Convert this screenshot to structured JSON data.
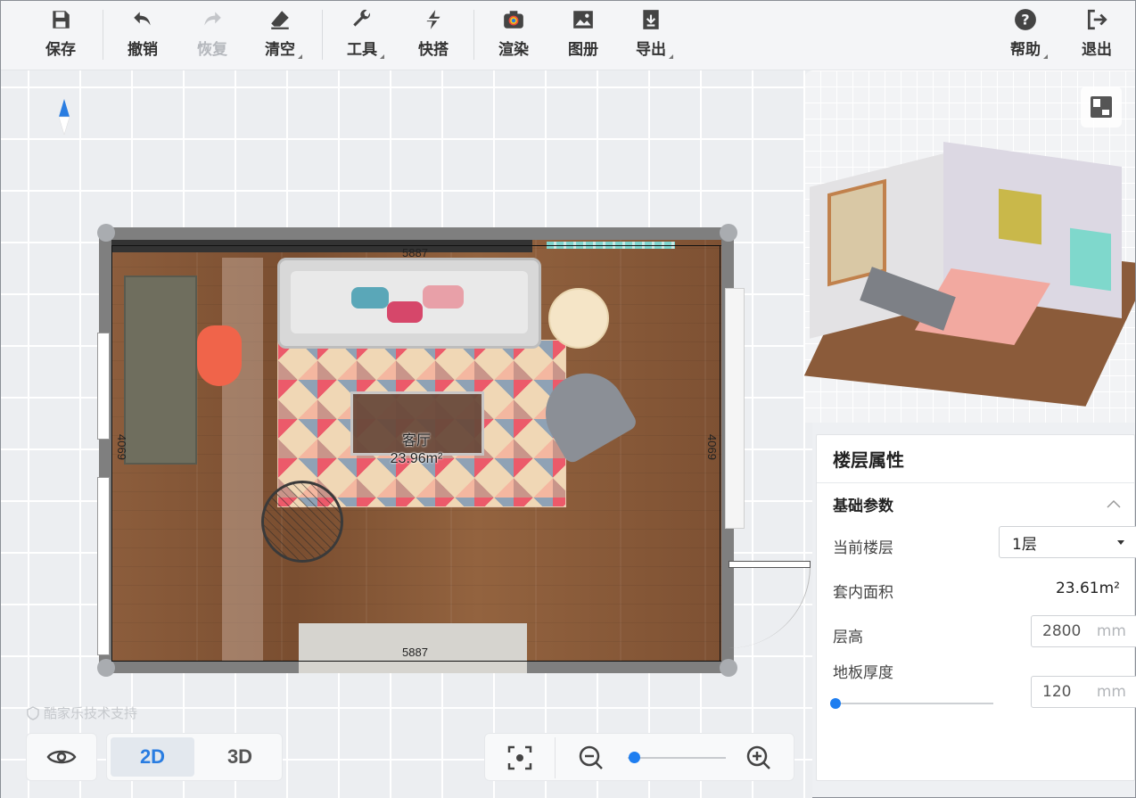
{
  "toolbar": {
    "save": "保存",
    "undo": "撤销",
    "redo": "恢复",
    "clear": "清空",
    "tools": "工具",
    "quick": "快搭",
    "render": "渲染",
    "album": "图册",
    "export": "导出",
    "help": "帮助",
    "exit": "退出"
  },
  "plan": {
    "room_name": "客厅",
    "room_area": "23.96m²",
    "dim_top": "5887",
    "dim_bottom": "5887",
    "dim_left": "4069",
    "dim_right": "4069"
  },
  "watermark": "酷家乐技术支持",
  "view_toggle": {
    "opt_2d": "2D",
    "opt_3d": "3D",
    "active": "2D"
  },
  "zoom": {
    "level": 0.03
  },
  "panel": {
    "title": "楼层属性",
    "section": "基础参数",
    "current_floor_label": "当前楼层",
    "current_floor_value": "1层",
    "inner_area_label": "套内面积",
    "inner_area_value": "23.61m²",
    "height_label": "层高",
    "height_value": "2800",
    "height_unit": "mm",
    "thickness_label": "地板厚度",
    "thickness_value": "120",
    "thickness_unit": "mm",
    "thickness_slider": 0.0
  },
  "colors": {
    "accent": "#1e7ef0",
    "wall": "#7f7f7f",
    "floor": "#8c5d3c"
  }
}
